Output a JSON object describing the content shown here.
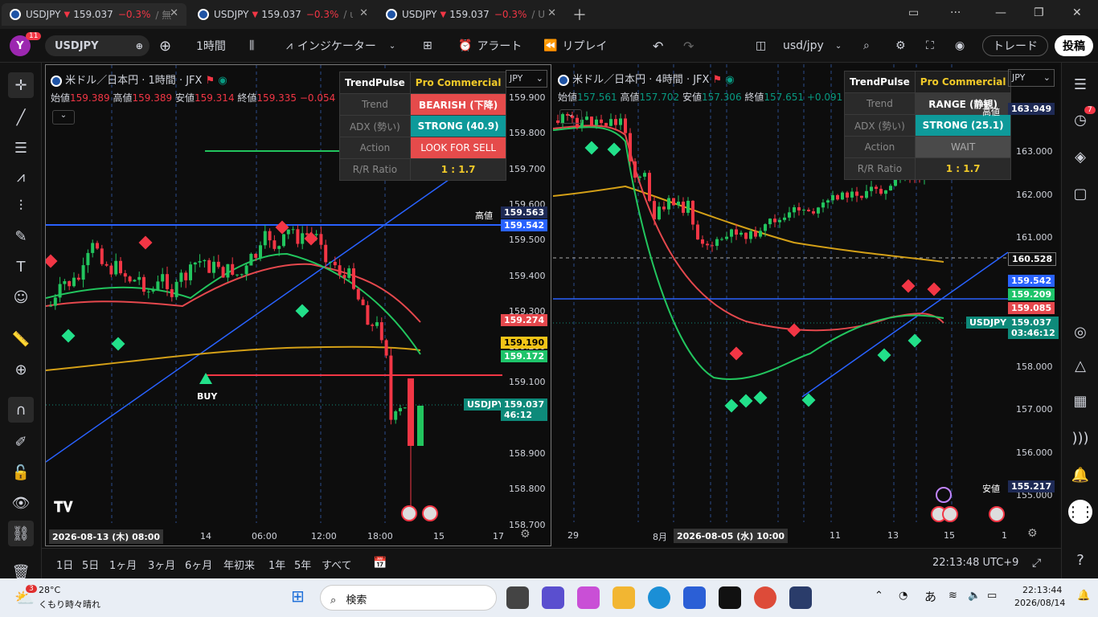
{
  "tabs": [
    {
      "label": "USDJPY",
      "price": "159.037",
      "change": "−0.3%",
      "suffix": "/ 無"
    },
    {
      "label": "USDJPY",
      "price": "159.037",
      "change": "−0.3%",
      "suffix": "/ ι"
    },
    {
      "label": "USDJPY",
      "price": "159.037",
      "change": "−0.3%",
      "suffix": "/ U"
    }
  ],
  "toolbar": {
    "avatar_letter": "Y",
    "notif_count": "11",
    "symbol": "USDJPY",
    "interval": "1時間",
    "indicators": "インジケーター",
    "alert": "アラート",
    "replay": "リプレイ",
    "layout_name": "usd/jpy",
    "trade": "トレード",
    "publish": "投稿"
  },
  "left_chart": {
    "title": "米ドル／日本円 · 1時間 · JFX",
    "ohlc": {
      "o_label": "始値",
      "o": "159.389",
      "h_label": "高値",
      "h": "159.389",
      "l_label": "安値",
      "l": "159.314",
      "c_label": "終値",
      "c": "159.335",
      "chg": "−0.054 (−0.03%)"
    },
    "currency": "JPY",
    "panel": {
      "h1": "TrendPulse",
      "h2": "Pro Commercial",
      "rows": [
        {
          "k": "Trend",
          "v": "BEARISH (下降)",
          "color": "#e54b4b"
        },
        {
          "k": "ADX (勢い)",
          "v": "STRONG (40.9)",
          "color": "#0e9a9a"
        },
        {
          "k": "Action",
          "v": "LOOK FOR SELL",
          "color": "#e54b4b"
        },
        {
          "k": "R/R Ratio",
          "v": "1 : 1.7",
          "color": "#2a2a2a"
        }
      ]
    },
    "yticks": [
      "159.900",
      "159.800",
      "159.700",
      "159.600",
      "159.500",
      "159.400",
      "159.300",
      "159.200",
      "159.100",
      "159.000",
      "158.900",
      "158.800",
      "158.700"
    ],
    "xticks": [
      "14",
      "06:00",
      "12:00",
      "18:00",
      "15",
      "17"
    ],
    "cursor_date": "2026-08-13 (木)  08:00",
    "labels": {
      "high_tag": "高値",
      "high": "159.563",
      "blue": "159.542",
      "red": "159.274",
      "yellow": "159.190",
      "green": "159.172",
      "sym": "USDJPY",
      "last": "159.037",
      "countdown": "46:12"
    },
    "buy": "BUY"
  },
  "right_chart": {
    "title": "米ドル／日本円 · 4時間 · JFX",
    "ohlc": {
      "o_label": "始値",
      "o": "157.561",
      "h_label": "高値",
      "h": "157.702",
      "l_label": "安値",
      "l": "157.306",
      "c_label": "終値",
      "c": "157.651",
      "chg": "+0.091 (+0.06%)"
    },
    "currency": "JPY",
    "panel": {
      "h1": "TrendPulse",
      "h2": "Pro Commercial",
      "rows": [
        {
          "k": "Trend",
          "v": "RANGE (静観)",
          "color": "#3a3a3a"
        },
        {
          "k": "ADX (勢い)",
          "v": "STRONG (25.1)",
          "color": "#0e9a9a"
        },
        {
          "k": "Action",
          "v": "WAIT",
          "color": "#4a4a4a"
        },
        {
          "k": "R/R Ratio",
          "v": "1 : 1.7",
          "color": "#2a2a2a"
        }
      ]
    },
    "yticks": [
      "163.000",
      "162.000",
      "161.000",
      "160.000",
      "159.000",
      "158.000",
      "157.000",
      "156.000",
      "155.000"
    ],
    "xticks": [
      "29",
      "8月",
      "11",
      "13",
      "15",
      "1"
    ],
    "cursor_date": "2026-08-05 (水)  10:00",
    "labels": {
      "high_tag": "高値",
      "high": "163.949",
      "dashed": "160.528",
      "blue": "159.542",
      "green": "159.209",
      "red": "159.085",
      "sym": "USDJPY",
      "last": "159.037",
      "countdown": "03:46:12",
      "low_tag": "安値",
      "low": "155.217"
    }
  },
  "bottom": {
    "ranges": [
      "1日",
      "5日",
      "1ヶ月",
      "3ヶ月",
      "6ヶ月",
      "年初来",
      "1年",
      "5年",
      "すべて"
    ],
    "clock": "22:13:48 UTC+9"
  },
  "taskbar": {
    "weather_temp": "28°C",
    "weather_desc": "くもり時々晴れ",
    "weather_badge": "3",
    "search": "検索",
    "time": "22:13:44",
    "date": "2026/08/14",
    "ime": "あ"
  }
}
